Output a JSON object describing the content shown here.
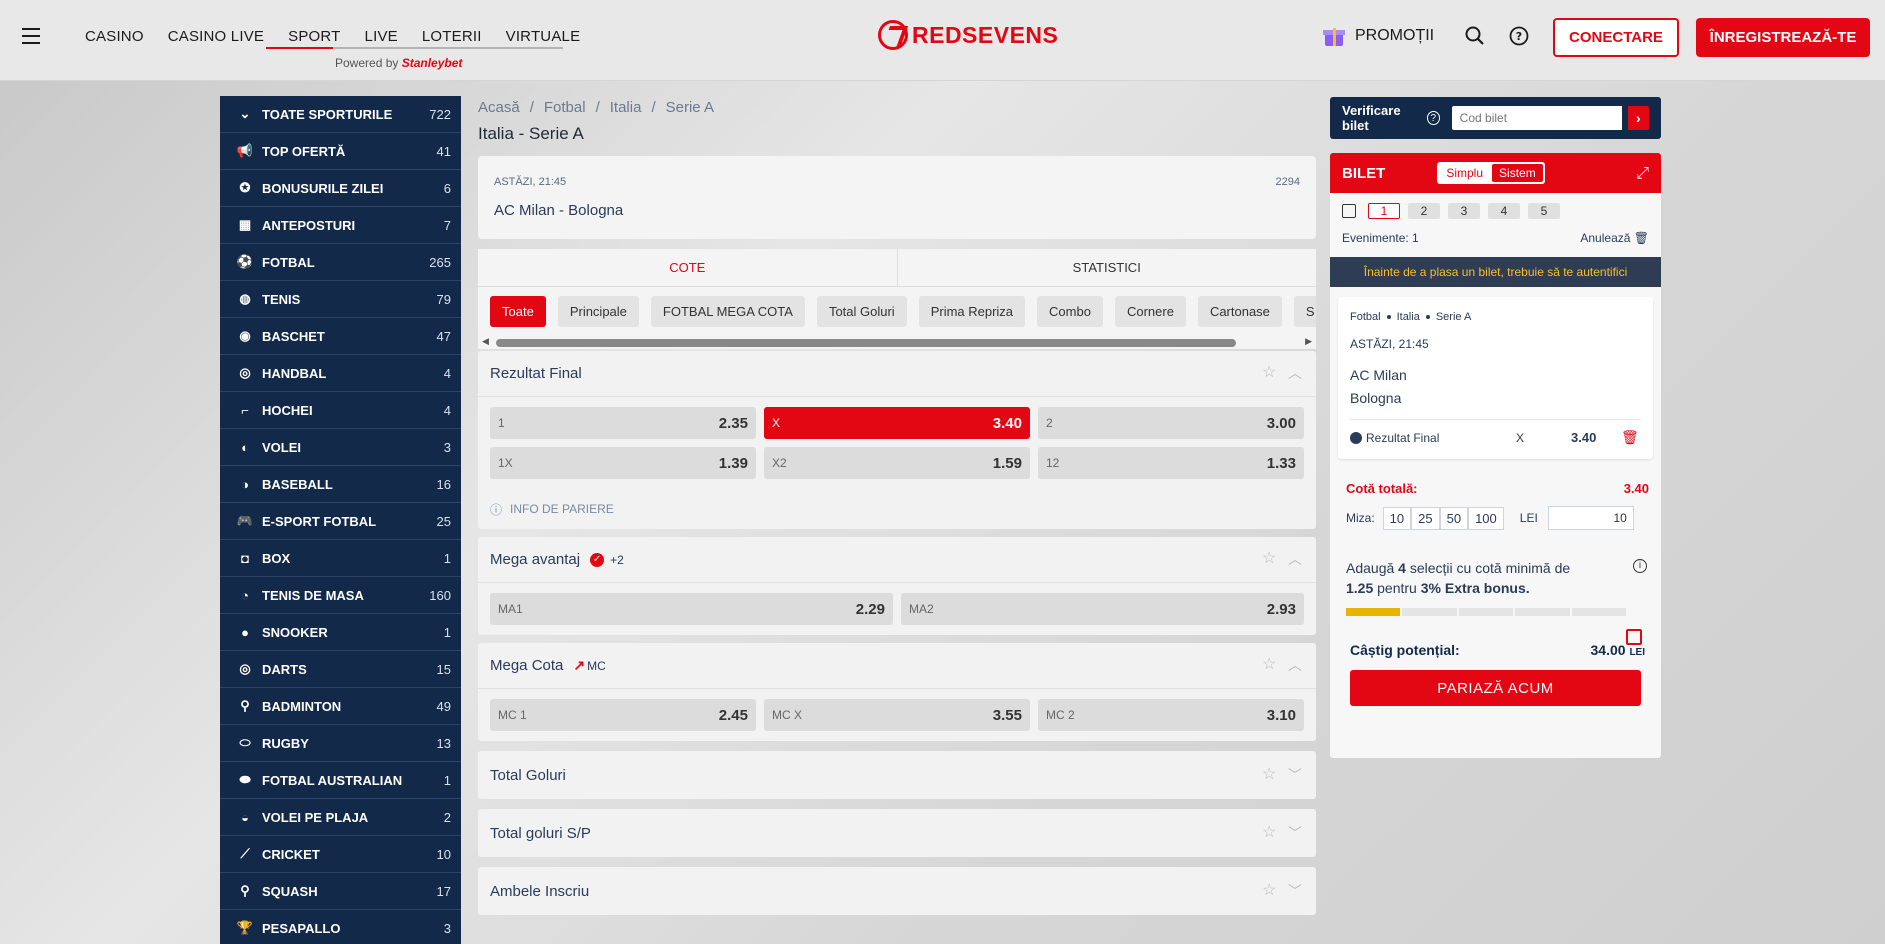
{
  "header": {
    "nav": [
      "CASINO",
      "CASINO LIVE",
      "SPORT",
      "LIVE",
      "LOTERII",
      "VIRTUALE"
    ],
    "powered_by": "Powered by",
    "powered_brand": "Stanleybet",
    "logo_text": "REDSEVENS",
    "promo_label": "PROMOȚII",
    "login_label": "CONECTARE",
    "register_label": "ÎNREGISTREAZĂ-TE"
  },
  "sidebar": {
    "items": [
      {
        "label": "TOATE SPORTURILE",
        "count": "722",
        "icon": "chevron-down-icon"
      },
      {
        "label": "TOP OFERTĂ",
        "count": "41",
        "icon": "megaphone-icon"
      },
      {
        "label": "BONUSURILE ZILEI",
        "count": "6",
        "icon": "star-circle-icon"
      },
      {
        "label": "ANTEPOSTURI",
        "count": "7",
        "icon": "grid-icon"
      },
      {
        "label": "FOTBAL",
        "count": "265",
        "icon": "football-icon"
      },
      {
        "label": "TENIS",
        "count": "79",
        "icon": "tennis-icon"
      },
      {
        "label": "BASCHET",
        "count": "47",
        "icon": "basketball-icon"
      },
      {
        "label": "HANDBAL",
        "count": "4",
        "icon": "handball-icon"
      },
      {
        "label": "HOCHEI",
        "count": "4",
        "icon": "hockey-icon"
      },
      {
        "label": "VOLEI",
        "count": "3",
        "icon": "volleyball-icon"
      },
      {
        "label": "BASEBALL",
        "count": "16",
        "icon": "baseball-icon"
      },
      {
        "label": "E-SPORT FOTBAL",
        "count": "25",
        "icon": "gamepad-icon"
      },
      {
        "label": "BOX",
        "count": "1",
        "icon": "boxing-glove-icon"
      },
      {
        "label": "TENIS DE MASA",
        "count": "160",
        "icon": "table-tennis-icon"
      },
      {
        "label": "SNOOKER",
        "count": "1",
        "icon": "snooker-icon"
      },
      {
        "label": "DARTS",
        "count": "15",
        "icon": "darts-icon"
      },
      {
        "label": "BADMINTON",
        "count": "49",
        "icon": "badminton-icon"
      },
      {
        "label": "RUGBY",
        "count": "13",
        "icon": "rugby-icon"
      },
      {
        "label": "FOTBAL AUSTRALIAN",
        "count": "1",
        "icon": "australian-football-icon"
      },
      {
        "label": "VOLEI PE PLAJA",
        "count": "2",
        "icon": "beach-volleyball-icon"
      },
      {
        "label": "CRICKET",
        "count": "10",
        "icon": "cricket-icon"
      },
      {
        "label": "SQUASH",
        "count": "17",
        "icon": "squash-icon"
      },
      {
        "label": "PESAPALLO",
        "count": "3",
        "icon": "trophy-icon"
      }
    ]
  },
  "breadcrumb": [
    "Acasă",
    "Fotbal",
    "Italia",
    "Serie A"
  ],
  "page_title": "Italia - Serie A",
  "event": {
    "time": "ASTĂZI, 21:45",
    "id": "2294",
    "name": "AC Milan - Bologna"
  },
  "tabs": [
    "COTE",
    "STATISTICI"
  ],
  "chips": [
    "Toate",
    "Principale",
    "FOTBAL MEGA COTA",
    "Total Goluri",
    "Prima Repriza",
    "Combo",
    "Cornere",
    "Cartonase",
    "S"
  ],
  "markets": {
    "rezultat": {
      "title": "Rezultat Final",
      "row1": [
        {
          "label": "1",
          "odd": "2.35"
        },
        {
          "label": "X",
          "odd": "3.40"
        },
        {
          "label": "2",
          "odd": "3.00"
        }
      ],
      "row2": [
        {
          "label": "1X",
          "odd": "1.39"
        },
        {
          "label": "X2",
          "odd": "1.59"
        },
        {
          "label": "12",
          "odd": "1.33"
        }
      ],
      "info": "INFO DE PARIERE"
    },
    "mega_avantaj": {
      "title": "Mega avantaj",
      "extra": "+2",
      "odds": [
        {
          "label": "MA1",
          "odd": "2.29"
        },
        {
          "label": "MA2",
          "odd": "2.93"
        }
      ]
    },
    "mega_cota": {
      "title": "Mega Cota",
      "badge": "MC",
      "odds": [
        {
          "label": "MC 1",
          "odd": "2.45"
        },
        {
          "label": "MC X",
          "odd": "3.55"
        },
        {
          "label": "MC 2",
          "odd": "3.10"
        }
      ]
    },
    "collapsed": [
      "Total Goluri",
      "Total goluri S/P",
      "Ambele Inscriu"
    ]
  },
  "verify": {
    "label": "Verificare bilet",
    "placeholder": "Cod bilet"
  },
  "betslip": {
    "title": "BILET",
    "modes": [
      "Simplu",
      "Sistem"
    ],
    "tabs": [
      "1",
      "2",
      "3",
      "4",
      "5"
    ],
    "events_label": "Evenimente: 1",
    "cancel_label": "Anulează",
    "warning": "Înainte de a plasa un bilet, trebuie să te autentifici",
    "selection": {
      "path": [
        "Fotbal",
        "Italia",
        "Serie A"
      ],
      "time": "ASTĂZI, 21:45",
      "team1": "AC Milan",
      "team2": "Bologna",
      "market": "Rezultat Final",
      "pick": "X",
      "odd": "3.40"
    },
    "total_label": "Cotă totală:",
    "total_value": "3.40",
    "stake_label": "Miza:",
    "stakes": [
      "10",
      "25",
      "50",
      "100"
    ],
    "currency": "LEI",
    "stake_value": "10",
    "bonus_pre": "Adaugă",
    "bonus_n": "4",
    "bonus_mid": "selecții cu cotă minimă de",
    "bonus_min": "1.25",
    "bonus_mid2": "pentru",
    "bonus_pct": "3% Extra bonus.",
    "bonus_progress": 0.2,
    "potential_label": "Câștig potențial:",
    "potential_value": "34.00",
    "potential_currency": "LEI",
    "bet_label": "PARIAZĂ ACUM"
  },
  "colors": {
    "brand_red": "#e30613",
    "sidebar_navy": "#12294a",
    "warning_yellow": "#fbbf24",
    "progress_gold": "#e8b400"
  }
}
